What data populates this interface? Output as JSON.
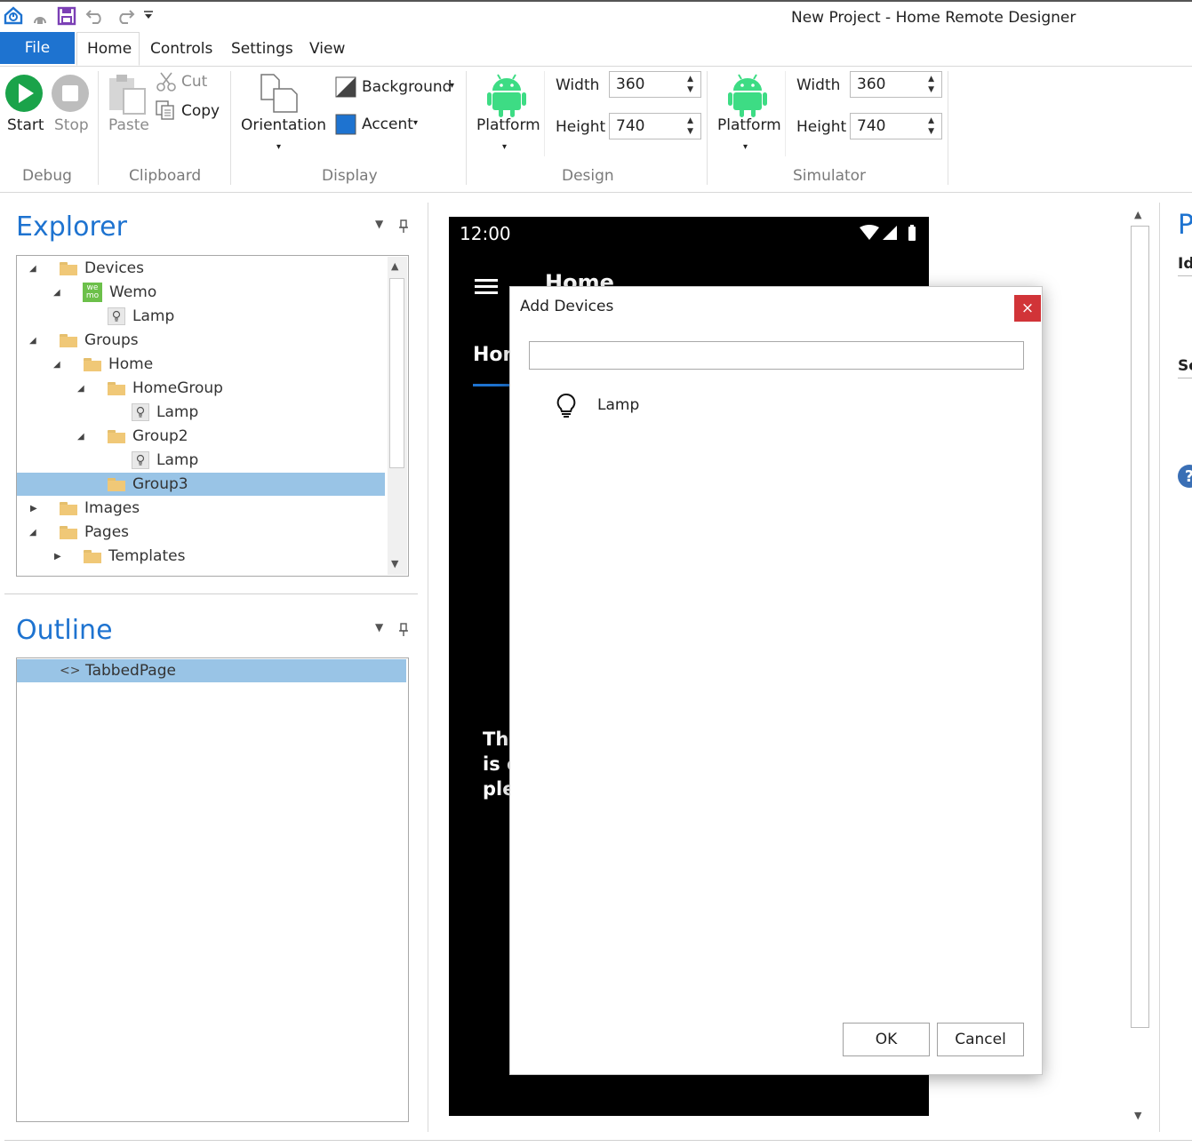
{
  "window": {
    "title": "New Project - Home Remote Designer"
  },
  "menu": {
    "file": "File",
    "tabs": [
      "Home",
      "Controls",
      "Settings",
      "View"
    ]
  },
  "ribbon": {
    "debug": {
      "label": "Debug",
      "start": "Start",
      "stop": "Stop"
    },
    "clipboard": {
      "label": "Clipboard",
      "paste": "Paste",
      "cut": "Cut",
      "copy": "Copy"
    },
    "display": {
      "label": "Display",
      "orientation": "Orientation",
      "background": "Background",
      "accent": "Accent"
    },
    "design": {
      "label": "Design",
      "platform": "Platform",
      "width_label": "Width",
      "width": "360",
      "height_label": "Height",
      "height": "740"
    },
    "simulator": {
      "label": "Simulator",
      "platform": "Platform",
      "width_label": "Width",
      "width": "360",
      "height_label": "Height",
      "height": "740"
    }
  },
  "explorer": {
    "title": "Explorer",
    "items": [
      {
        "label": "Devices",
        "icon": "folder-open"
      },
      {
        "label": "Wemo",
        "icon": "wemo-logo"
      },
      {
        "label": "Lamp",
        "icon": "lightbulb"
      },
      {
        "label": "Groups",
        "icon": "folder-open"
      },
      {
        "label": "Home",
        "icon": "folder-open"
      },
      {
        "label": "HomeGroup",
        "icon": "folder-open"
      },
      {
        "label": "Lamp",
        "icon": "lightbulb"
      },
      {
        "label": "Group2",
        "icon": "folder-open"
      },
      {
        "label": "Lamp",
        "icon": "lightbulb"
      },
      {
        "label": "Group3",
        "icon": "folder"
      },
      {
        "label": "Images",
        "icon": "folder"
      },
      {
        "label": "Pages",
        "icon": "folder-open"
      },
      {
        "label": "Templates",
        "icon": "folder"
      }
    ],
    "wemo_logo": {
      "line1": "we",
      "line2": "mo"
    }
  },
  "outline": {
    "title": "Outline",
    "items": [
      {
        "label": "TabbedPage",
        "icon": "code-brackets"
      }
    ]
  },
  "phone": {
    "time": "12:00",
    "header_title": "Home",
    "tab_label": "Hom",
    "body_lines": [
      "Thi",
      "is c",
      "ple"
    ]
  },
  "dialog": {
    "title": "Add Devices",
    "search_value": "",
    "items": [
      {
        "label": "Lamp",
        "icon": "lightbulb"
      }
    ],
    "ok": "OK",
    "cancel": "Cancel",
    "close_color": "#d13438"
  },
  "right_panel": {
    "title_partial": "P",
    "label1": "Id",
    "label2": "Se"
  },
  "colors": {
    "accent": "#1e73d0",
    "selection": "#99c4e6",
    "android_green": "#3ddc84"
  }
}
